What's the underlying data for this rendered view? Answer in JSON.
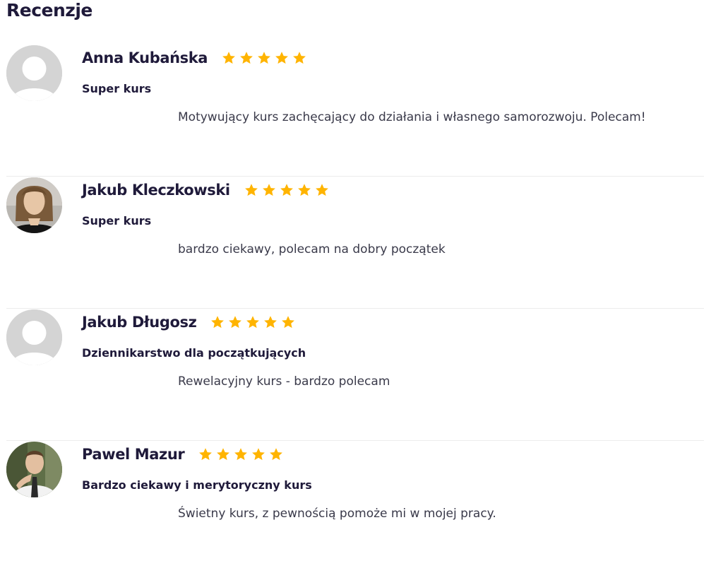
{
  "section": {
    "title": "Recenzje"
  },
  "colors": {
    "star": "#ffb400",
    "text": "#1f1a3a",
    "divider": "#ececec",
    "avatar_placeholder": "#d4d4d4"
  },
  "reviews": [
    {
      "name": "Anna Kubańska",
      "rating": 5,
      "title": "Super kurs",
      "body": "Motywujący kurs zachęcający do działania i własnego samorozwoju. Polecam!",
      "avatar": "default-avatar-icon"
    },
    {
      "name": "Jakub Kleczkowski",
      "rating": 5,
      "title": "Super kurs",
      "body": "bardzo ciekawy, polecam na dobry początek",
      "avatar": "user-photo"
    },
    {
      "name": "Jakub Długosz",
      "rating": 5,
      "title": "Dziennikarstwo dla początkujących",
      "body": "Rewelacyjny kurs - bardzo polecam",
      "avatar": "default-avatar-icon"
    },
    {
      "name": "Pawel Mazur",
      "rating": 5,
      "title": "Bardzo ciekawy i merytoryczny kurs",
      "body": "Świetny kurs, z pewnością pomoże mi w mojej pracy.",
      "avatar": "user-photo"
    }
  ]
}
